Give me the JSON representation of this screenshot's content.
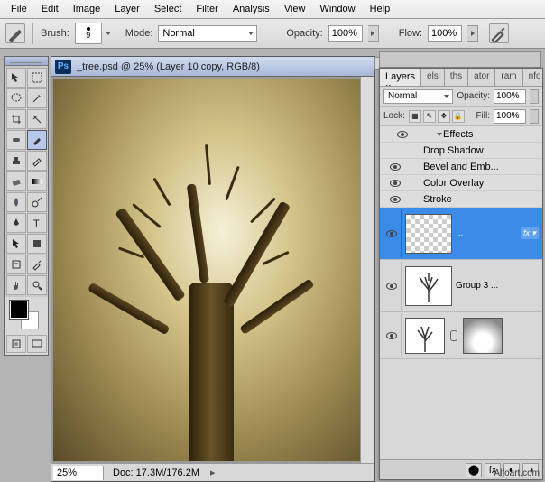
{
  "menu": {
    "file": "File",
    "edit": "Edit",
    "image": "Image",
    "layer": "Layer",
    "select": "Select",
    "filter": "Filter",
    "analysis": "Analysis",
    "view": "View",
    "window": "Window",
    "help": "Help"
  },
  "options": {
    "brush_label": "Brush:",
    "brush_size": "9",
    "mode_label": "Mode:",
    "mode_value": "Normal",
    "opacity_label": "Opacity:",
    "opacity_value": "100%",
    "flow_label": "Flow:",
    "flow_value": "100%"
  },
  "document": {
    "title": "_tree.psd @ 25% (Layer 10 copy, RGB/8)",
    "zoom": "25%",
    "docsize": "Doc: 17.3M/176.2M"
  },
  "panel": {
    "tabs": [
      "Layers",
      "els",
      "ths",
      "ator",
      "ram",
      "nfo"
    ],
    "blend_mode": "Normal",
    "opacity_label": "Opacity:",
    "opacity_value": "100%",
    "lock_label": "Lock:",
    "fill_label": "Fill:",
    "fill_value": "100%",
    "effects_label": "Effects",
    "fx": [
      "Drop Shadow",
      "Bevel and Emb...",
      "Color Overlay",
      "Stroke"
    ],
    "layer_selected": "...",
    "group_name": "Group 3 ..."
  },
  "watermark": "Alfoart.com"
}
